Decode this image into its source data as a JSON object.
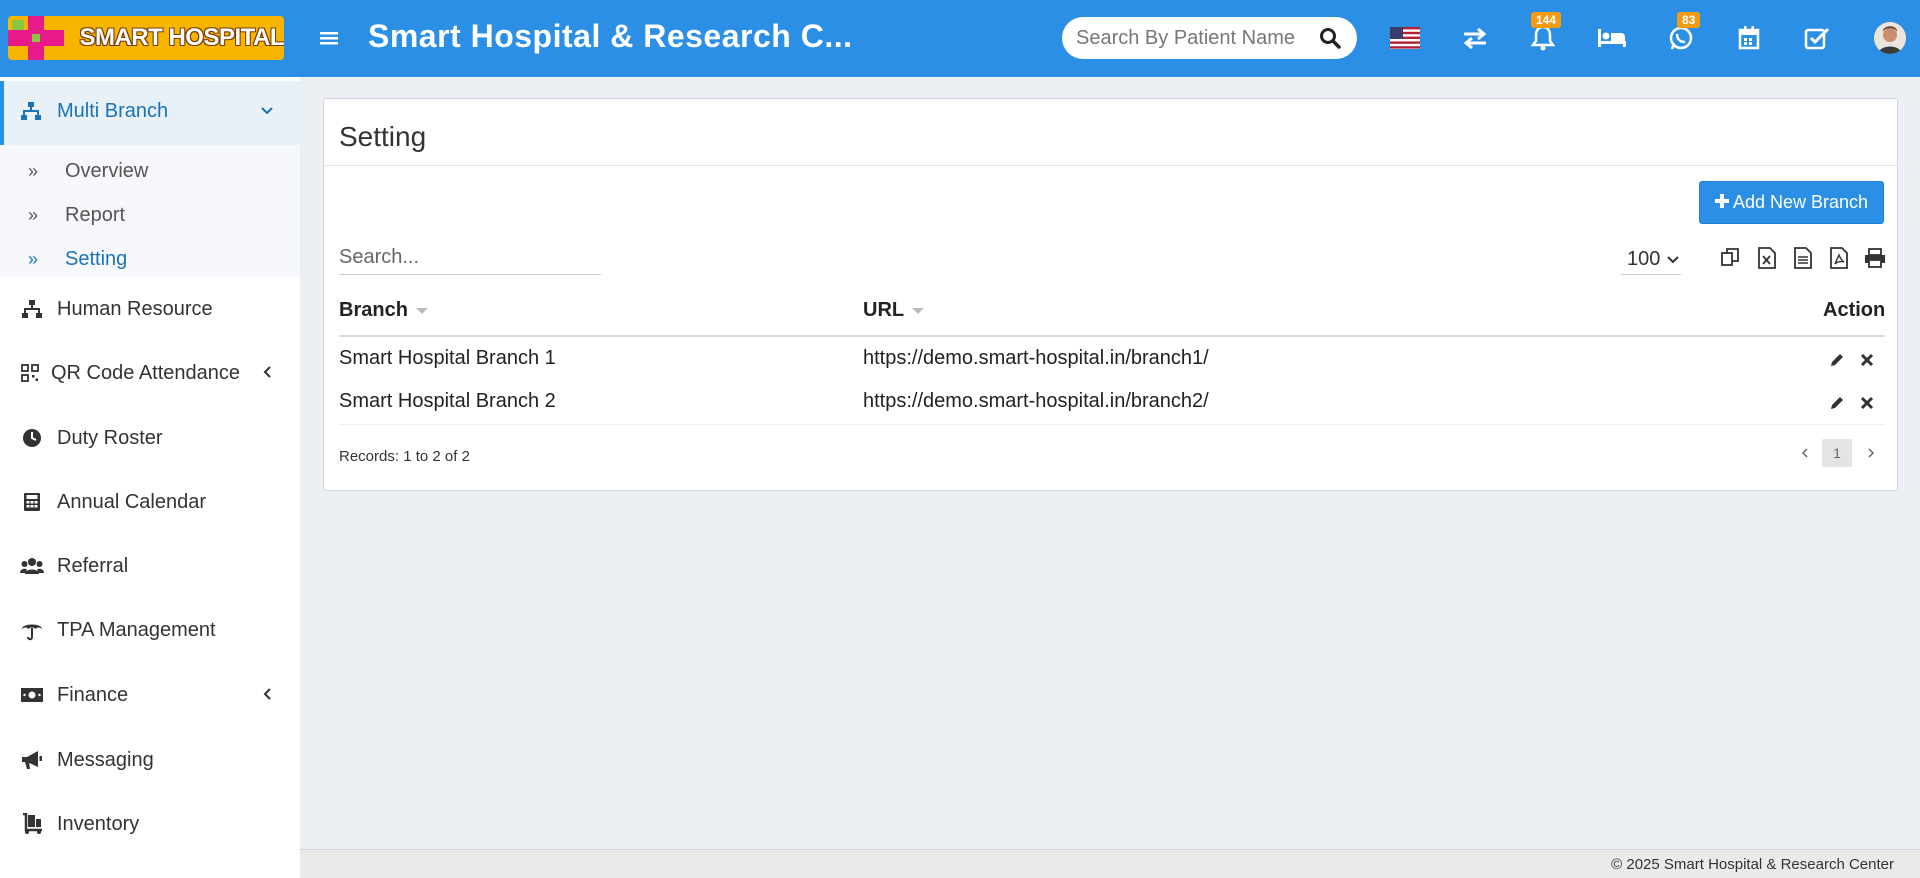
{
  "header": {
    "logo_text": "SMART HOSPITAL",
    "app_title": "Smart Hospital & Research C...",
    "search_placeholder": "Search By Patient Name",
    "notifications_badge": "144",
    "whatsapp_badge": "83"
  },
  "sidebar": {
    "multi_branch": "Multi Branch",
    "sub_items": [
      "Overview",
      "Report",
      "Setting"
    ],
    "items": [
      "Human Resource",
      "QR Code Attendance",
      "Duty Roster",
      "Annual Calendar",
      "Referral",
      "TPA Management",
      "Finance",
      "Messaging",
      "Inventory"
    ]
  },
  "main": {
    "title": "Setting",
    "add_button": "Add New Branch",
    "search_placeholder": "Search...",
    "page_length": "100",
    "columns": [
      "Branch",
      "URL",
      "Action"
    ],
    "rows": [
      {
        "branch": "Smart Hospital Branch 1",
        "url": "https://demo.smart-hospital.in/branch1/"
      },
      {
        "branch": "Smart Hospital Branch 2",
        "url": "https://demo.smart-hospital.in/branch2/"
      }
    ],
    "records": "Records: 1 to 2 of 2",
    "current_page": "1"
  },
  "footer": {
    "copyright": "© 2025 Smart Hospital & Research Center"
  },
  "colors": {
    "header_bg": "#2b8fe6",
    "accent": "#2b8fe6",
    "badge": "#f39c12"
  }
}
